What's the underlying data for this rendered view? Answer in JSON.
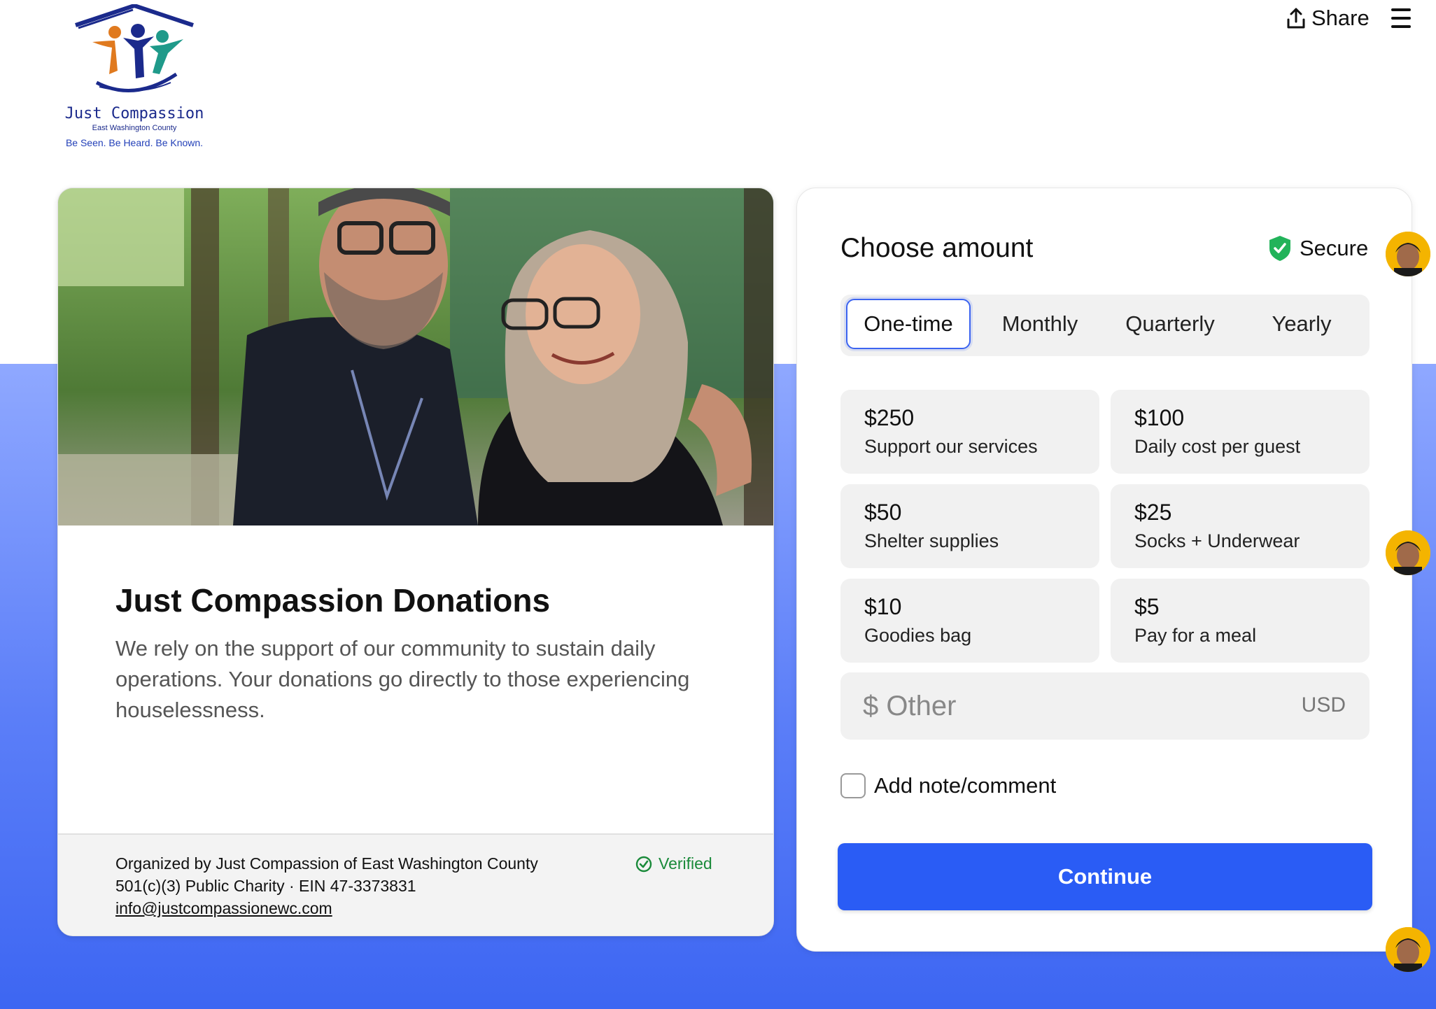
{
  "logo": {
    "name": "Just Compassion",
    "subtitle": "East Washington County",
    "tagline": "Be Seen. Be Heard. Be Known."
  },
  "header": {
    "share_label": "Share",
    "share_icon": "share-upload-icon",
    "menu_icon": "hamburger-menu-icon"
  },
  "campaign": {
    "title": "Just Compassion Donations",
    "description": "We rely on the support of our community to sustain daily operations. Your donations go directly to those experiencing houselessness.",
    "organizer": "Organized by Just Compassion of East Washington County",
    "charity_info": "501(c)(3) Public Charity · EIN 47-3373831",
    "email": "info@justcompassionewc.com",
    "verified_label": "Verified"
  },
  "donate": {
    "title": "Choose amount",
    "secure_label": "Secure",
    "frequency": {
      "selected": "One-time",
      "tabs": [
        "One-time",
        "Monthly",
        "Quarterly",
        "Yearly"
      ]
    },
    "amounts": [
      {
        "value": "$250",
        "label": "Support our services"
      },
      {
        "value": "$100",
        "label": "Daily cost per guest"
      },
      {
        "value": "$50",
        "label": "Shelter supplies"
      },
      {
        "value": "$25",
        "label": "Socks + Underwear"
      },
      {
        "value": "$10",
        "label": "Goodies bag"
      },
      {
        "value": "$5",
        "label": "Pay for a meal"
      }
    ],
    "other_placeholder": "$ Other",
    "currency": "USD",
    "note_label": "Add note/comment",
    "note_checked": false,
    "continue_label": "Continue"
  },
  "colors": {
    "accent": "#2a5cf5",
    "verified": "#1a8a3a",
    "secure_shield": "#22b35a",
    "brand_navy": "#1b2a8c"
  }
}
